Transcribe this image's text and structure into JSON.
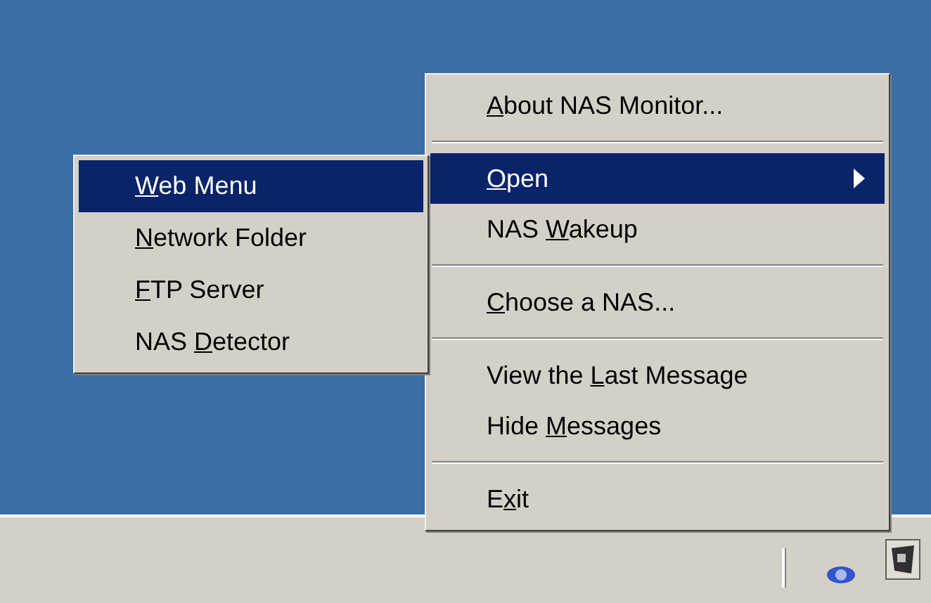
{
  "context_menu": {
    "items": [
      {
        "kind": "item",
        "access_key": "A",
        "label_end": "bout NAS Monitor...",
        "selected": false,
        "submenu": false
      },
      {
        "kind": "separator"
      },
      {
        "kind": "item",
        "access_key": "O",
        "label_end": "pen",
        "selected": true,
        "submenu": true
      },
      {
        "kind": "item",
        "label_start": "NAS ",
        "access_key": "W",
        "label_end": "akeup",
        "selected": false,
        "submenu": false
      },
      {
        "kind": "separator"
      },
      {
        "kind": "item",
        "access_key": "C",
        "label_end": "hoose a NAS...",
        "selected": false,
        "submenu": false
      },
      {
        "kind": "separator"
      },
      {
        "kind": "item",
        "label_start": "View the ",
        "access_key": "L",
        "label_end": "ast Message",
        "selected": false,
        "submenu": false
      },
      {
        "kind": "item",
        "label_start": "Hide ",
        "access_key": "M",
        "label_end": "essages",
        "selected": false,
        "submenu": false
      },
      {
        "kind": "separator"
      },
      {
        "kind": "item",
        "label_start": "E",
        "access_key": "x",
        "label_end": "it",
        "selected": false,
        "submenu": false
      }
    ]
  },
  "submenu": {
    "items": [
      {
        "access_key": "W",
        "label_end": "eb Menu",
        "selected": true
      },
      {
        "access_key": "N",
        "label_end": "etwork Folder",
        "selected": false
      },
      {
        "access_key": "F",
        "label_end": "TP Server",
        "selected": false
      },
      {
        "label_start": "NAS ",
        "access_key": "D",
        "label_end": "etector",
        "selected": false
      }
    ]
  }
}
